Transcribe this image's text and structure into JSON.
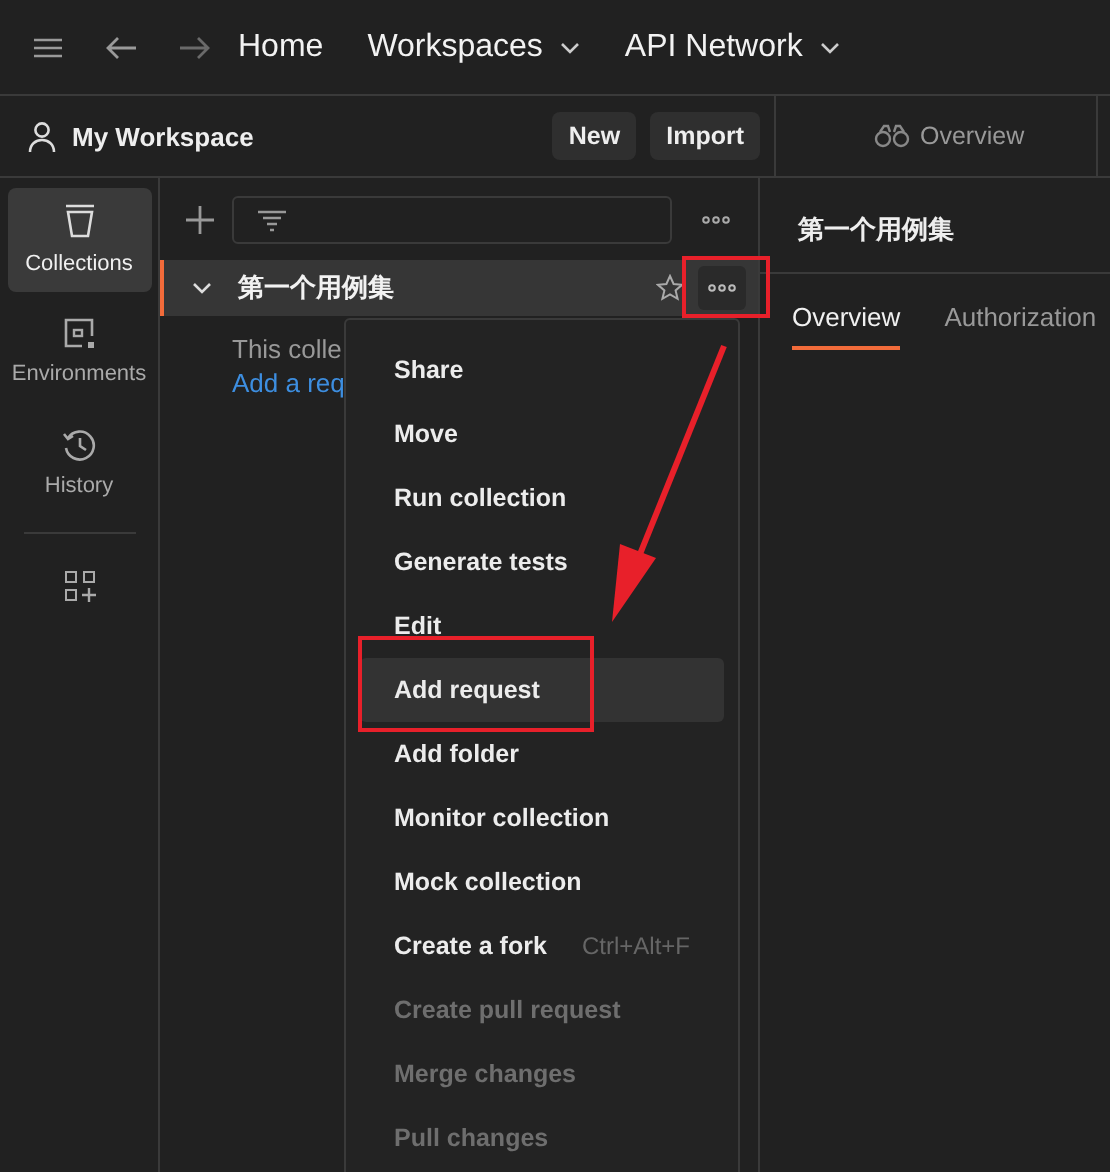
{
  "top_bar": {
    "nav": [
      {
        "label": "Home",
        "dropdown": false
      },
      {
        "label": "Workspaces",
        "dropdown": true
      },
      {
        "label": "API Network",
        "dropdown": true
      }
    ]
  },
  "workspace": {
    "name": "My Workspace",
    "buttons": [
      "New",
      "Import"
    ]
  },
  "rail": [
    {
      "label": "Collections",
      "kind": "collections",
      "selected": true
    },
    {
      "label": "Environments",
      "kind": "environments",
      "selected": false
    },
    {
      "label": "History",
      "kind": "history",
      "selected": false
    }
  ],
  "collection": {
    "name": "第一个用例集",
    "empty_text": "This colle",
    "link": "Add a req"
  },
  "menu": [
    {
      "label": "Share",
      "selected": false,
      "disabled": false
    },
    {
      "label": "Move",
      "selected": false,
      "disabled": false
    },
    {
      "label": "Run collection",
      "selected": false,
      "disabled": false
    },
    {
      "label": "Generate tests",
      "selected": false,
      "disabled": false
    },
    {
      "label": "Edit",
      "selected": false,
      "disabled": false
    },
    {
      "label": "Add request",
      "selected": true,
      "disabled": false
    },
    {
      "label": "Add folder",
      "selected": false,
      "disabled": false
    },
    {
      "label": "Monitor collection",
      "selected": false,
      "disabled": false
    },
    {
      "label": "Mock collection",
      "selected": false,
      "disabled": false
    },
    {
      "label": "Create a fork",
      "shortcut": "Ctrl+Alt+F",
      "selected": false,
      "disabled": false
    },
    {
      "label": "Create pull request",
      "selected": false,
      "disabled": true
    },
    {
      "label": "Merge changes",
      "selected": false,
      "disabled": true
    },
    {
      "label": "Pull changes",
      "selected": false,
      "disabled": true
    }
  ],
  "right_panel": {
    "tab": "Overview",
    "title": "第一个用例集",
    "tabs": [
      {
        "label": "Overview",
        "selected": true
      },
      {
        "label": "Authorization",
        "selected": false
      }
    ]
  }
}
